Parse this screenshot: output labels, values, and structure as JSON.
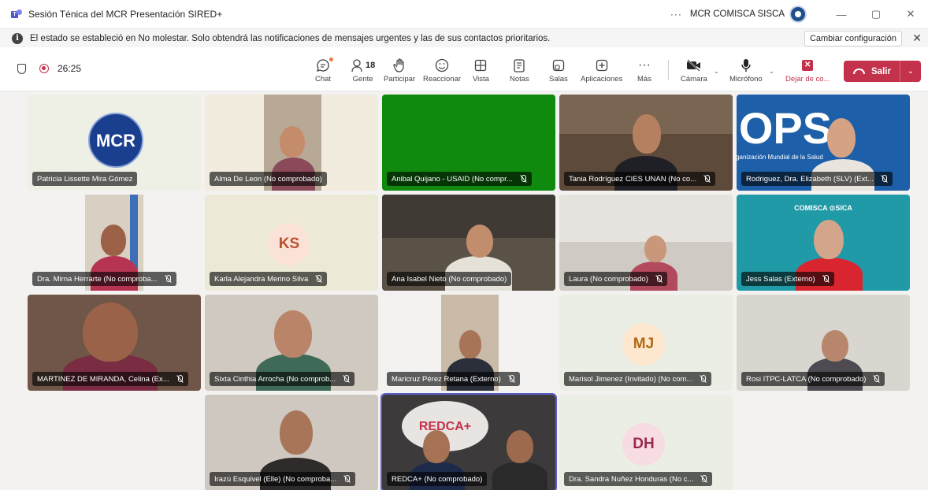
{
  "window": {
    "title": "Sesión Ténica del MCR Presentación SIRED+",
    "more": "···",
    "org": "MCR COMISCA SISCA",
    "minimize": "—",
    "restore": "▢",
    "close": "✕"
  },
  "notification": {
    "icon": "i",
    "text": "El estado se estableció en No molestar. Solo obtendrá las notificaciones de mensajes urgentes y las de sus contactos prioritarios.",
    "button": "Cambiar configuración",
    "close": "✕"
  },
  "meeting": {
    "timer": "26:25",
    "participant_count": "18"
  },
  "toolbar": {
    "chat": "Chat",
    "people": "Gente",
    "raise": "Participar",
    "react": "Reaccionar",
    "view": "Vista",
    "notes": "Notas",
    "rooms": "Salas",
    "apps": "Aplicaciones",
    "more": "Más",
    "more_glyph": "···",
    "camera": "Cámara",
    "mic": "Micrófono",
    "stop_share": "Dejar de co...",
    "stop_glyph": "✕",
    "leave": "Salir",
    "chevron": "⌄"
  },
  "participants": [
    {
      "name": "Patricia Lissette Mira Gómez",
      "muted": false
    },
    {
      "name": "Alma De Leon (No comprobado)",
      "muted": false
    },
    {
      "name": "Anibal Quijano - USAID (No compr...",
      "muted": true
    },
    {
      "name": "Tania Rodríguez CIES UNAN (No co...",
      "muted": true
    },
    {
      "name": "Rodriguez, Dra. Elizabeth (SLV) (Ext...",
      "muted": true
    },
    {
      "name": "Dra. Mirna Herrarte (No comproba...",
      "muted": true
    },
    {
      "name": "Karla Alejandra Merino Silva",
      "muted": true,
      "initials": "KS"
    },
    {
      "name": "Ana Isabel Nieto (No comprobado)",
      "muted": false
    },
    {
      "name": "Laura (No comprobado)",
      "muted": true
    },
    {
      "name": "Jess Salas (Externo)",
      "muted": true
    },
    {
      "name": "MARTINEZ DE MIRANDA, Celina (Ex...",
      "muted": true
    },
    {
      "name": "Sixta Cinthia Arrocha (No comprob...",
      "muted": true
    },
    {
      "name": "Maricruz Pérez Retana (Externo)",
      "muted": true
    },
    {
      "name": "Marisol Jimenez (Invitado) (No com...",
      "muted": true,
      "initials": "MJ"
    },
    {
      "name": "Rosi ITPC-LATCA (No comprobado)",
      "muted": true
    },
    {
      "name": "Irazú Esquivel (Elle) (No comproba...",
      "muted": true
    },
    {
      "name": "REDCA+ (No comprobado)",
      "muted": false
    },
    {
      "name": "Dra. Sandra Nuñez Honduras (No c...",
      "muted": true,
      "initials": "DH"
    }
  ],
  "logos": {
    "mcr": "MCR",
    "ops": "OPS",
    "ops_text": "Organización Mundial de la Salud",
    "sica": "COMISCA ⊙SICA",
    "redca": "REDCA+"
  },
  "colors": {
    "accent": "#5b5fc7",
    "leave": "#c4314b",
    "green_tile": "#0f8a0f"
  }
}
